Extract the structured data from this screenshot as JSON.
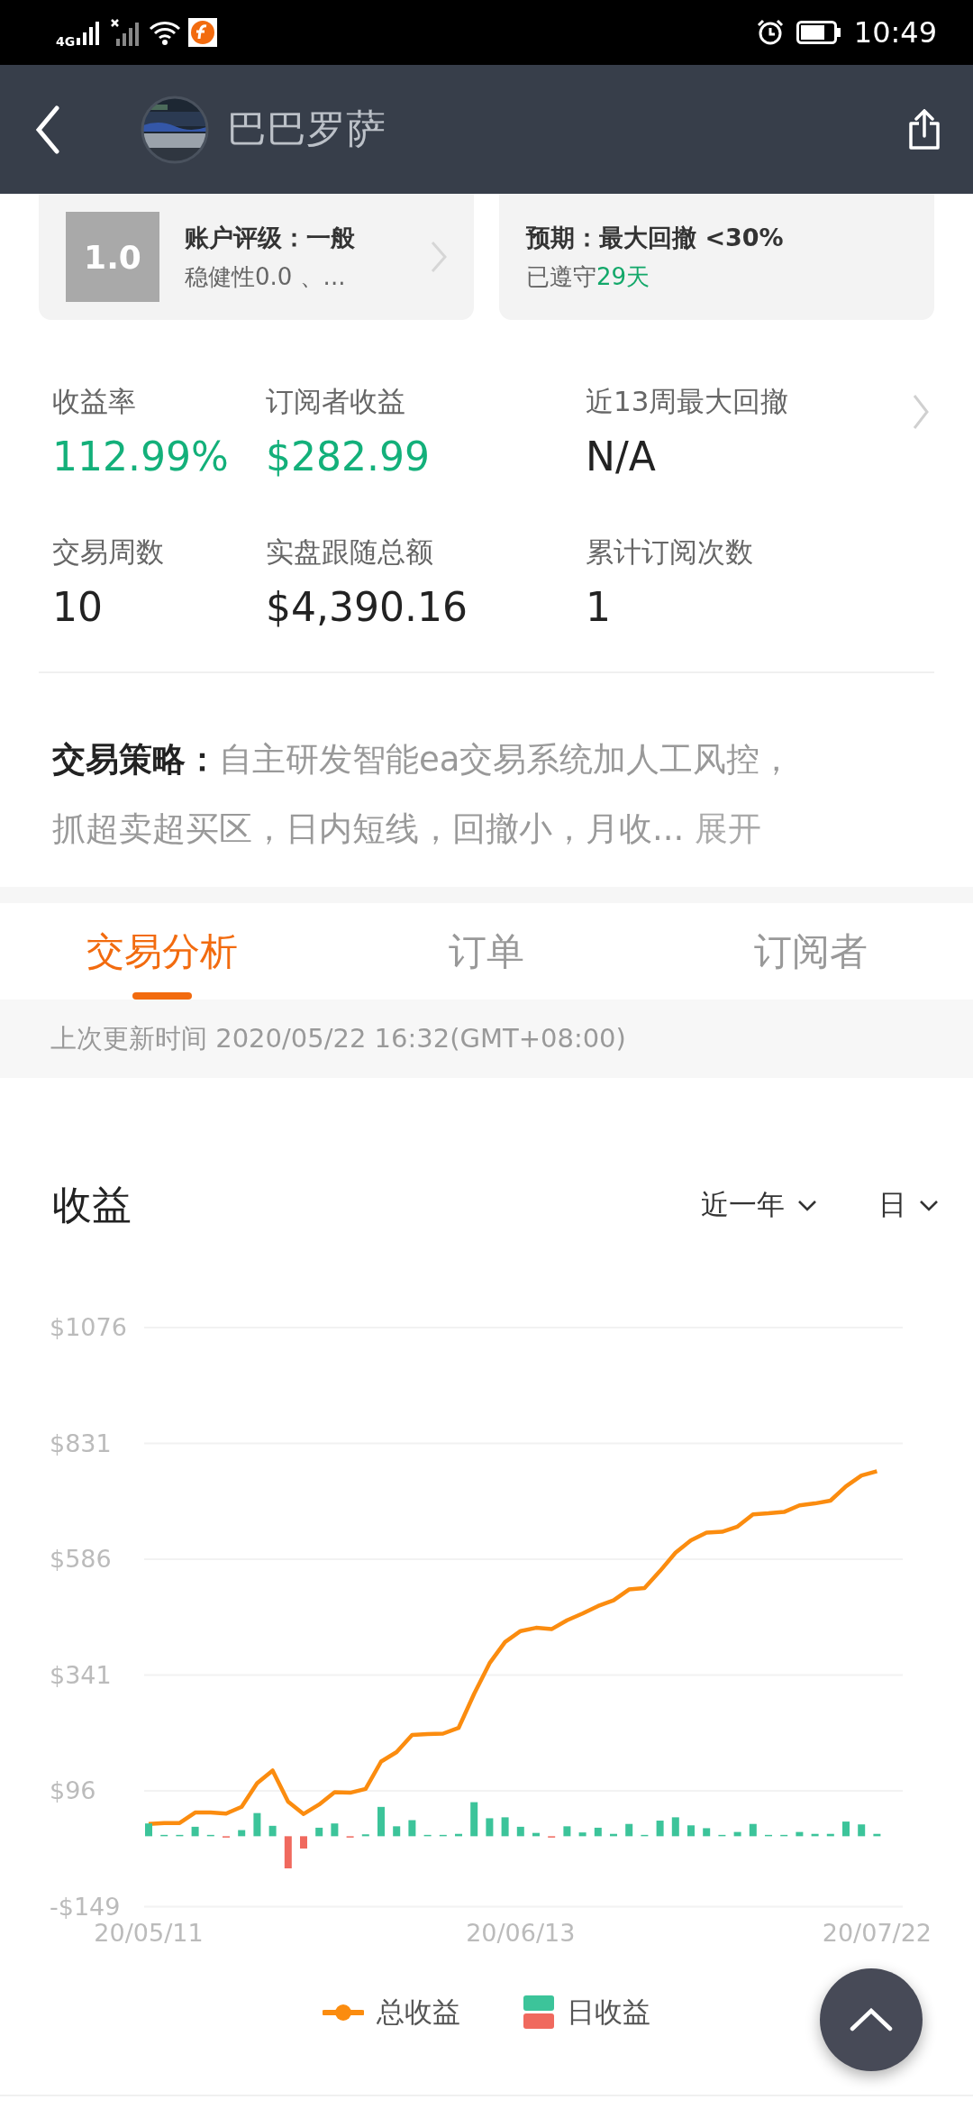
{
  "status_bar": {
    "network": "4G",
    "time": "10:49"
  },
  "header": {
    "title": "巴巴罗萨"
  },
  "rating_card": {
    "score": "1.0",
    "title": "账户评级：一般",
    "subtitle": "稳健性0.0 、..."
  },
  "expectation_card": {
    "title": "预期：最大回撤 <30%",
    "prefix": "已遵守",
    "highlight": "29天"
  },
  "stats": [
    {
      "label": "收益率",
      "value": "112.99%",
      "highlighted": true
    },
    {
      "label": "订阅者收益",
      "value": "$282.99",
      "highlighted": true
    },
    {
      "label": "近13周最大回撤",
      "value": "N/A",
      "highlighted": false
    },
    {
      "label": "交易周数",
      "value": "10",
      "highlighted": false
    },
    {
      "label": "实盘跟随总额",
      "value": "$4,390.16",
      "highlighted": false
    },
    {
      "label": "累计订阅次数",
      "value": "1",
      "highlighted": false
    }
  ],
  "strategy": {
    "label": "交易策略：",
    "text": "自主研发智能ea交易系统加人工风控，抓超卖超买区，日内短线，回撤小，月收...",
    "more": "展开"
  },
  "tabs": [
    {
      "label": "交易分析",
      "selected": true
    },
    {
      "label": "订单",
      "selected": false
    },
    {
      "label": "订阅者",
      "selected": false
    }
  ],
  "last_update": "上次更新时间 2020/05/22 16:32(GMT+08:00)",
  "profit": {
    "title": "收益",
    "filters": [
      "近一年",
      "日"
    ],
    "chart_data": {
      "type": "bar",
      "categories": [
        "20/05/11",
        null,
        null,
        null,
        null,
        null,
        null,
        null,
        null,
        null,
        null,
        null,
        null,
        null,
        null,
        null,
        null,
        null,
        null,
        null,
        null,
        null,
        null,
        null,
        "20/06/13",
        null,
        null,
        null,
        null,
        null,
        null,
        null,
        null,
        null,
        null,
        null,
        null,
        null,
        null,
        null,
        null,
        null,
        null,
        null,
        null,
        null,
        null,
        "20/07/22"
      ],
      "series": [
        {
          "name": "总收益",
          "type": "line",
          "color": "#fb8c0f",
          "values": [
            26,
            28,
            28,
            50,
            50,
            48,
            62,
            112,
            139,
            73,
            47,
            67,
            93,
            92,
            100,
            158,
            178,
            214,
            216,
            217,
            229,
            301,
            366,
            411,
            434,
            441,
            438,
            457,
            471,
            487,
            499,
            522,
            525,
            561,
            600,
            626,
            642,
            644,
            655,
            681,
            683,
            686,
            700,
            704,
            710,
            740,
            763,
            772
          ]
        },
        {
          "name": "日收益",
          "color": "#3cc49a",
          "values": [
            27,
            1,
            1,
            20,
            1,
            null,
            13,
            49,
            22,
            null,
            null,
            18,
            27,
            null,
            4,
            62,
            21,
            34,
            1,
            1,
            5,
            72,
            38,
            40,
            20,
            7,
            null,
            21,
            8,
            18,
            5,
            26,
            1,
            33,
            40,
            23,
            17,
            1,
            9,
            26,
            1,
            1,
            9,
            5,
            5,
            31,
            25,
            5
          ]
        },
        {
          "color": "#f0695e",
          "values": [
            null,
            null,
            null,
            null,
            null,
            -1,
            null,
            null,
            null,
            -68,
            -26,
            null,
            null,
            -2,
            null,
            null,
            null,
            null,
            null,
            null,
            null,
            null,
            null,
            null,
            null,
            null,
            -2,
            null,
            null,
            null,
            null,
            null,
            null,
            null,
            null,
            null,
            null,
            null,
            null,
            null,
            null,
            null,
            null,
            null,
            null,
            null,
            null,
            null
          ]
        }
      ],
      "grid": true,
      "ylim": [
        -149,
        1076
      ],
      "yticks": [
        {
          "value": 1076,
          "label": "$1076"
        },
        {
          "value": 831,
          "label": "$831"
        },
        {
          "value": 586,
          "label": "$586"
        },
        {
          "value": 341,
          "label": "$341"
        },
        {
          "value": 96,
          "label": "$96"
        },
        {
          "value": -149,
          "label": "-$149"
        }
      ]
    }
  }
}
